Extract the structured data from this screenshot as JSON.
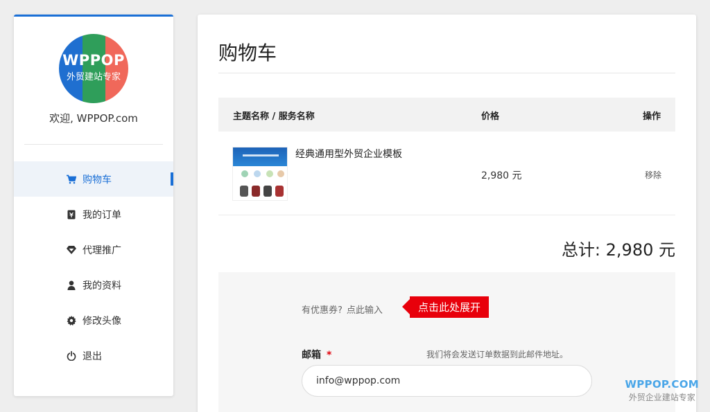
{
  "sidebar": {
    "logo": {
      "line1": "WPPOP",
      "line2": "外贸建站专家",
      "colors": [
        "#1f6fd0",
        "#2f9e5a",
        "#f0685a"
      ]
    },
    "welcome": "欢迎, WPPOP.com",
    "items": [
      {
        "label": "购物车",
        "icon": "cart-icon",
        "active": true
      },
      {
        "label": "我的订单",
        "icon": "order-icon",
        "active": false
      },
      {
        "label": "代理推广",
        "icon": "diamond-icon",
        "active": false
      },
      {
        "label": "我的资料",
        "icon": "user-icon",
        "active": false
      },
      {
        "label": "修改头像",
        "icon": "gear-icon",
        "active": false
      },
      {
        "label": "退出",
        "icon": "power-icon",
        "active": false
      }
    ]
  },
  "main": {
    "title": "购物车",
    "table": {
      "headers": [
        "主题名称 / 服务名称",
        "价格",
        "操作"
      ],
      "rows": [
        {
          "name": "经典通用型外贸企业模板",
          "price": "2,980 元",
          "action": "移除"
        }
      ]
    },
    "total": "总计: 2,980 元",
    "coupon": {
      "prompt": "有优惠券?",
      "link": "点此输入",
      "callout": "点击此处展开"
    },
    "email": {
      "label": "邮箱",
      "required": "*",
      "hint": "我们将会发送订单数据到此邮件地址。",
      "value": "info@wppop.com"
    }
  },
  "watermark": {
    "line1": "WPPOP.COM",
    "line2": "外贸企业建站专家"
  },
  "colors": {
    "accent": "#1a6fd6",
    "callout": "#e8000b"
  }
}
